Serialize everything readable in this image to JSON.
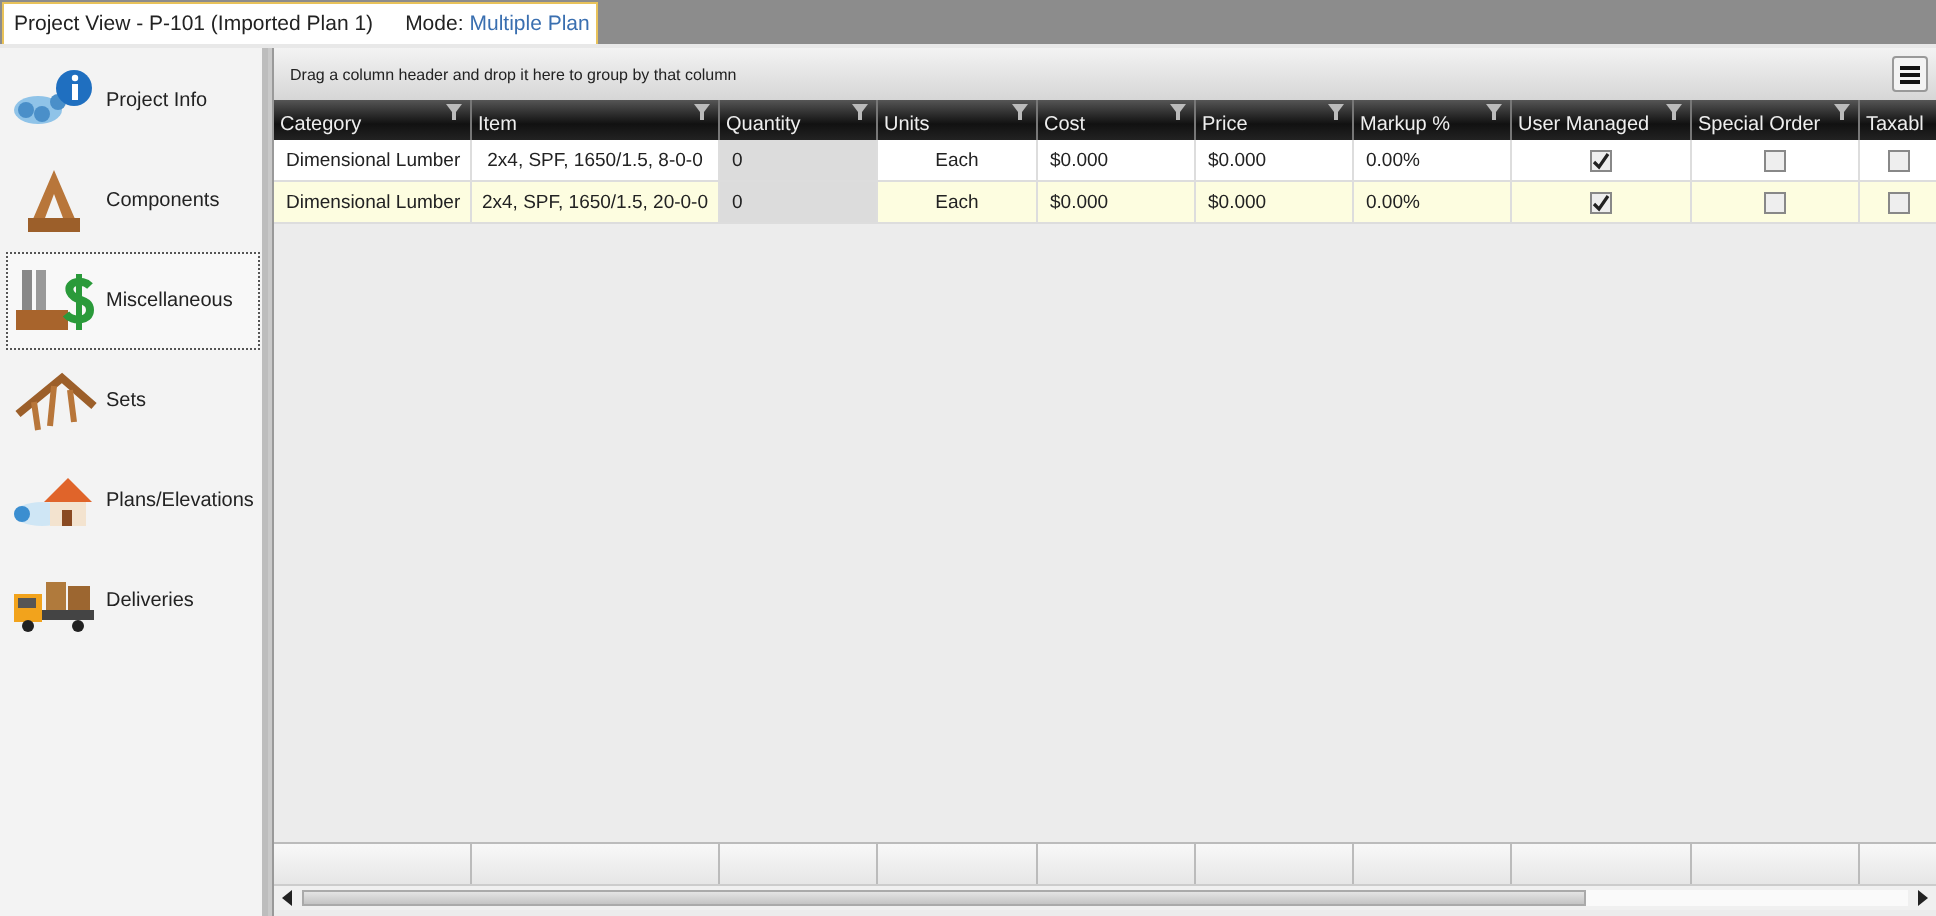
{
  "tab": {
    "title": "Project View - P-101 (Imported Plan 1)",
    "mode_label": "Mode:",
    "mode_value": "Multiple Plan",
    "selected": true
  },
  "sidebar": {
    "items": [
      {
        "label": "Project Info",
        "kind": "info",
        "selected": false
      },
      {
        "label": "Components",
        "kind": "components",
        "selected": false
      },
      {
        "label": "Miscellaneous",
        "kind": "misc",
        "selected": true
      },
      {
        "label": "Sets",
        "kind": "sets",
        "selected": false
      },
      {
        "label": "Plans/Elevations",
        "kind": "plans",
        "selected": false
      },
      {
        "label": "Deliveries",
        "kind": "deliveries",
        "selected": false
      }
    ]
  },
  "grid": {
    "group_hint": "Drag a column header and drop it here to group by that column",
    "columns": [
      {
        "label": "Category",
        "kind": "text",
        "filter": true
      },
      {
        "label": "Item",
        "kind": "text",
        "filter": true
      },
      {
        "label": "Quantity",
        "kind": "readonly",
        "filter": true
      },
      {
        "label": "Units",
        "kind": "text",
        "filter": true
      },
      {
        "label": "Cost",
        "kind": "text",
        "filter": true
      },
      {
        "label": "Price",
        "kind": "text",
        "filter": true
      },
      {
        "label": "Markup %",
        "kind": "text",
        "filter": true
      },
      {
        "label": "User Managed",
        "kind": "check",
        "filter": true
      },
      {
        "label": "Special Order",
        "kind": "check",
        "filter": true
      },
      {
        "label": "Taxabl",
        "kind": "check",
        "filter": false
      }
    ],
    "rows": [
      {
        "selected": false,
        "cells": [
          "Dimensional Lumber",
          "2x4, SPF, 1650/1.5, 8-0-0",
          "0",
          "Each",
          "$0.000",
          "$0.000",
          "0.00%",
          true,
          false,
          false
        ]
      },
      {
        "selected": true,
        "cells": [
          "Dimensional Lumber",
          "2x4, SPF, 1650/1.5, 20-0-0",
          "0",
          "Each",
          "$0.000",
          "$0.000",
          "0.00%",
          true,
          false,
          false
        ]
      }
    ]
  }
}
